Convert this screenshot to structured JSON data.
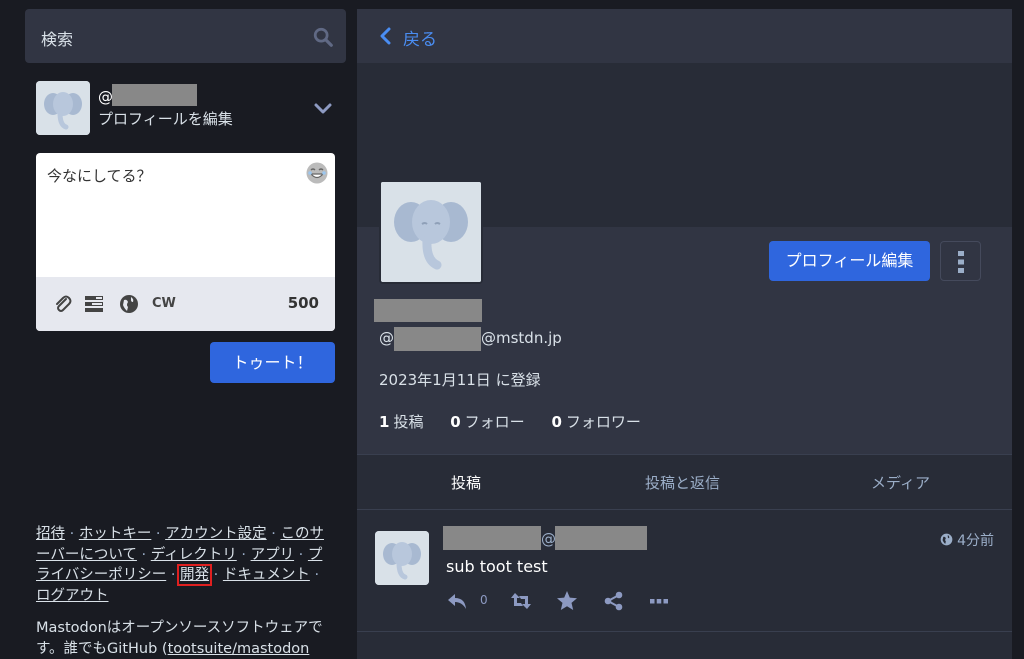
{
  "search": {
    "placeholder": "検索"
  },
  "account": {
    "handle_prefix": "@",
    "edit_profile_link": "プロフィールを編集"
  },
  "compose": {
    "placeholder": "今なにしてる？",
    "cw_label": "CW",
    "char_count": "500",
    "submit_label": "トゥート！"
  },
  "footer": {
    "links": [
      {
        "label": "招待"
      },
      {
        "label": "ホットキー"
      },
      {
        "label": "アカウント設定"
      },
      {
        "label": "このサーバーについて"
      },
      {
        "label": "ディレクトリ"
      },
      {
        "label": "アプリ"
      },
      {
        "label": "プライバシーポリシー"
      },
      {
        "label": "開発"
      },
      {
        "label": "ドキュメント"
      },
      {
        "label": "ログアウト"
      }
    ],
    "about_text": "Mastodonはオープンソースソフトウェアです。誰でもGitHub (",
    "repo_link": "tootsuite/mastodon"
  },
  "column": {
    "back_label": "戻る"
  },
  "profile": {
    "edit_button": "プロフィール編集",
    "acct_prefix": "@",
    "acct_domain": "@mstdn.jp",
    "joined": "2023年1月11日 に登録",
    "counts": [
      {
        "value": "1",
        "label": "投稿"
      },
      {
        "value": "0",
        "label": "フォロー"
      },
      {
        "value": "0",
        "label": "フォロワー"
      }
    ]
  },
  "tabs": [
    {
      "label": "投稿",
      "active": true
    },
    {
      "label": "投稿と返信",
      "active": false
    },
    {
      "label": "メディア",
      "active": false
    }
  ],
  "status": {
    "at_sep": "@",
    "time": "4分前",
    "content": "sub toot test",
    "reply_count": "0"
  },
  "colors": {
    "accent": "#2f66de",
    "link": "#4a8df2",
    "background": "#191b22",
    "panel": "#282c37",
    "highlight_box": "#e02020"
  }
}
